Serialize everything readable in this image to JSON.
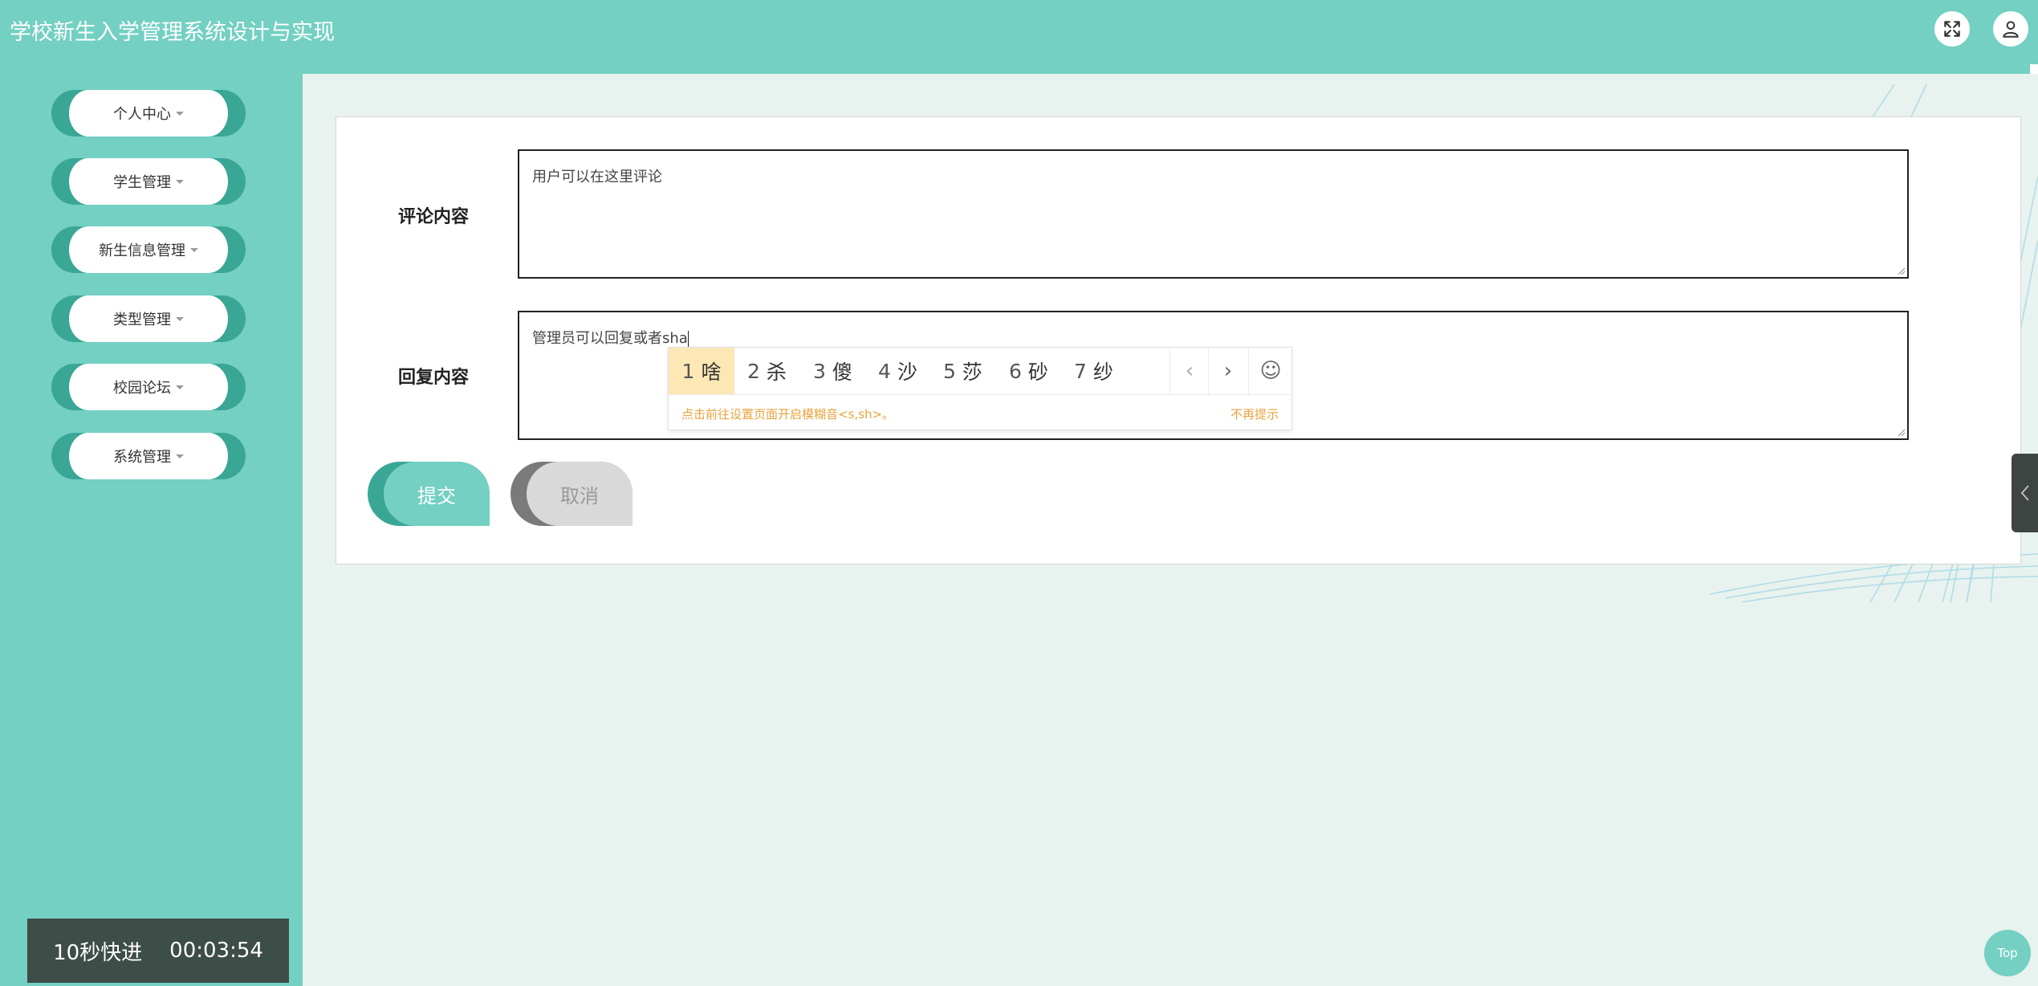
{
  "header": {
    "title": "学校新生入学管理系统设计与实现",
    "fullscreen_icon": "fullscreen-icon",
    "user_icon": "user-icon"
  },
  "sidebar": {
    "items": [
      {
        "label": "个人中心"
      },
      {
        "label": "学生管理"
      },
      {
        "label": "新生信息管理"
      },
      {
        "label": "类型管理"
      },
      {
        "label": "校园论坛"
      },
      {
        "label": "系统管理"
      }
    ]
  },
  "timer": {
    "label": "10秒快进",
    "time": "00:03:54"
  },
  "form": {
    "comment_label": "评论内容",
    "comment_value": "用户可以在这里评论",
    "reply_label": "回复内容",
    "reply_value": "管理员可以回复或者sha",
    "submit_label": "提交",
    "cancel_label": "取消"
  },
  "ime": {
    "candidates": [
      {
        "num": "1",
        "text": "啥"
      },
      {
        "num": "2",
        "text": "杀"
      },
      {
        "num": "3",
        "text": "傻"
      },
      {
        "num": "4",
        "text": "沙"
      },
      {
        "num": "5",
        "text": "莎"
      },
      {
        "num": "6",
        "text": "砂"
      },
      {
        "num": "7",
        "text": "纱"
      }
    ],
    "selected_index": 0,
    "prev_symbol": "‹",
    "next_symbol": "›",
    "emoji_symbol": "☺",
    "hint": "点击前往设置页面开启模糊音<s,sh>。",
    "dismiss": "不再提示"
  },
  "floating": {
    "top_label": "Top"
  },
  "colors": {
    "primary": "#73d0c2",
    "primary_dark": "#3aa696",
    "background": "#e8f2ee"
  }
}
